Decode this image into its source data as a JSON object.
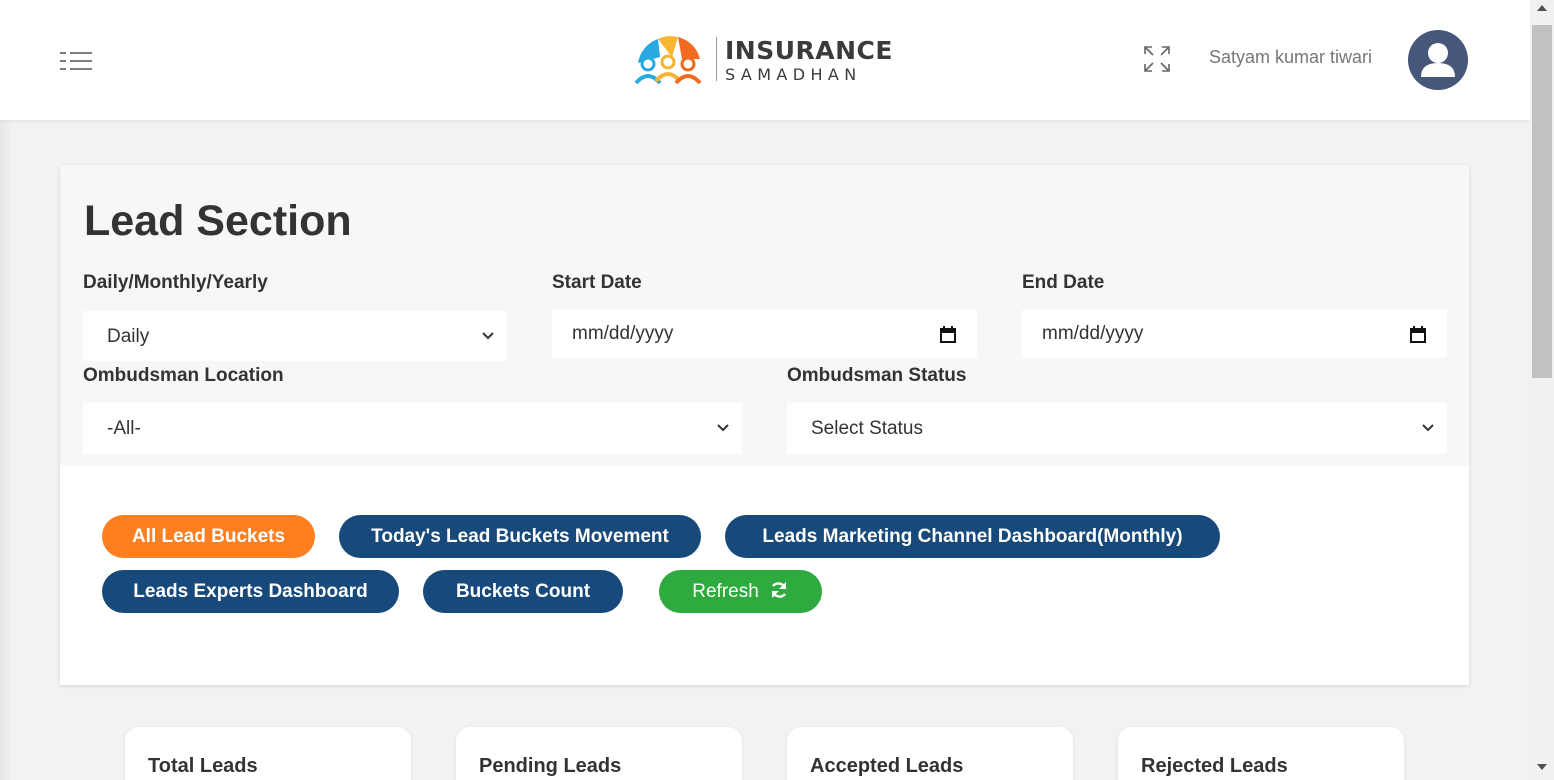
{
  "header": {
    "logo_line1": "INSURANCE",
    "logo_line2": "SAMADHAN",
    "username": "Satyam kumar tiwari",
    "icons": {
      "menu": "menu-icon",
      "fullscreen": "fullscreen-icon",
      "avatar": "user-avatar-icon"
    }
  },
  "lead_section": {
    "title": "Lead Section",
    "period_label": "Daily/Monthly/Yearly",
    "period_value": "Daily",
    "start_date_label": "Start Date",
    "start_date_placeholder": "mm/dd/yyyy",
    "end_date_label": "End Date",
    "end_date_placeholder": "mm/dd/yyyy",
    "location_label": "Ombudsman Location",
    "location_value": "-All-",
    "status_label": "Ombudsman Status",
    "status_value": "Select Status"
  },
  "buttons": {
    "all_lead_buckets": "All Lead Buckets",
    "todays_movement": "Today's Lead Buckets Movement",
    "marketing_channel": "Leads Marketing Channel Dashboard(Monthly)",
    "experts_dashboard": "Leads Experts Dashboard",
    "buckets_count": "Buckets Count",
    "refresh": "Refresh"
  },
  "stats": [
    {
      "title": "Total Leads"
    },
    {
      "title": "Pending Leads"
    },
    {
      "title": "Accepted Leads"
    },
    {
      "title": "Rejected Leads"
    }
  ],
  "colors": {
    "orange": "#fd7f1f",
    "navy": "#17497b",
    "green": "#2eaa3f",
    "avatar": "#46577a"
  }
}
